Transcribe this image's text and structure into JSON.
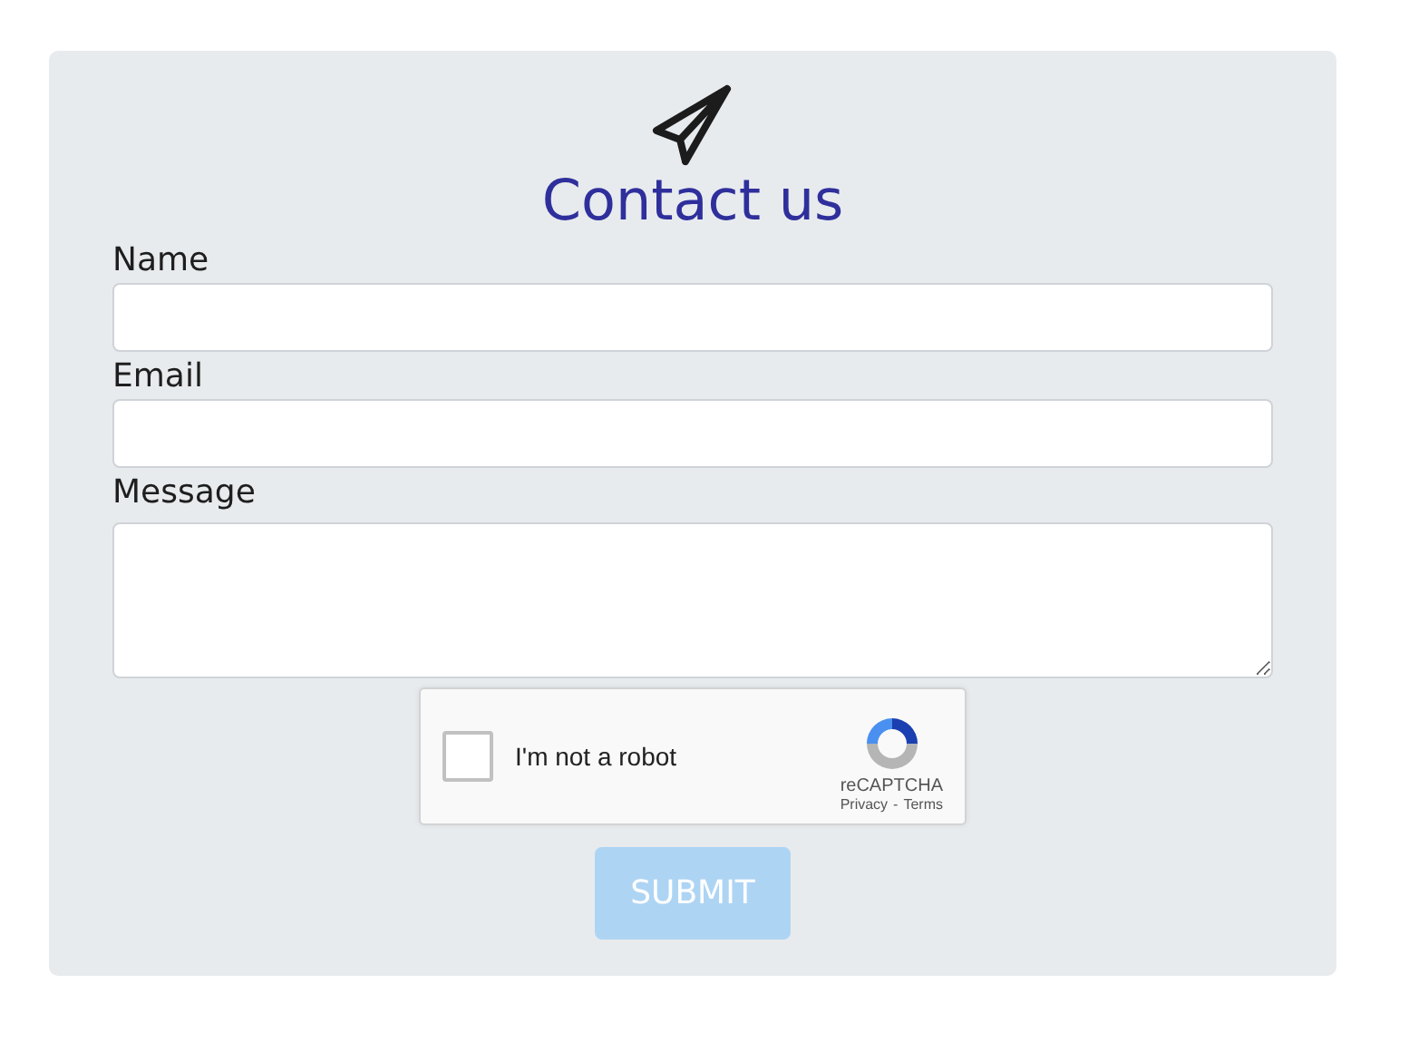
{
  "title": "Contact us",
  "fields": [
    {
      "label": "Name",
      "kind": "input"
    },
    {
      "label": "Email",
      "kind": "input"
    },
    {
      "label": "Message",
      "kind": "textarea"
    }
  ],
  "captcha": {
    "label": "I'm not a robot",
    "checked": false,
    "brand": "reCAPTCHA",
    "links": [
      "Privacy",
      "Terms"
    ],
    "separator": "-"
  },
  "submit": {
    "label": "SUBMIT",
    "disabled": true
  }
}
